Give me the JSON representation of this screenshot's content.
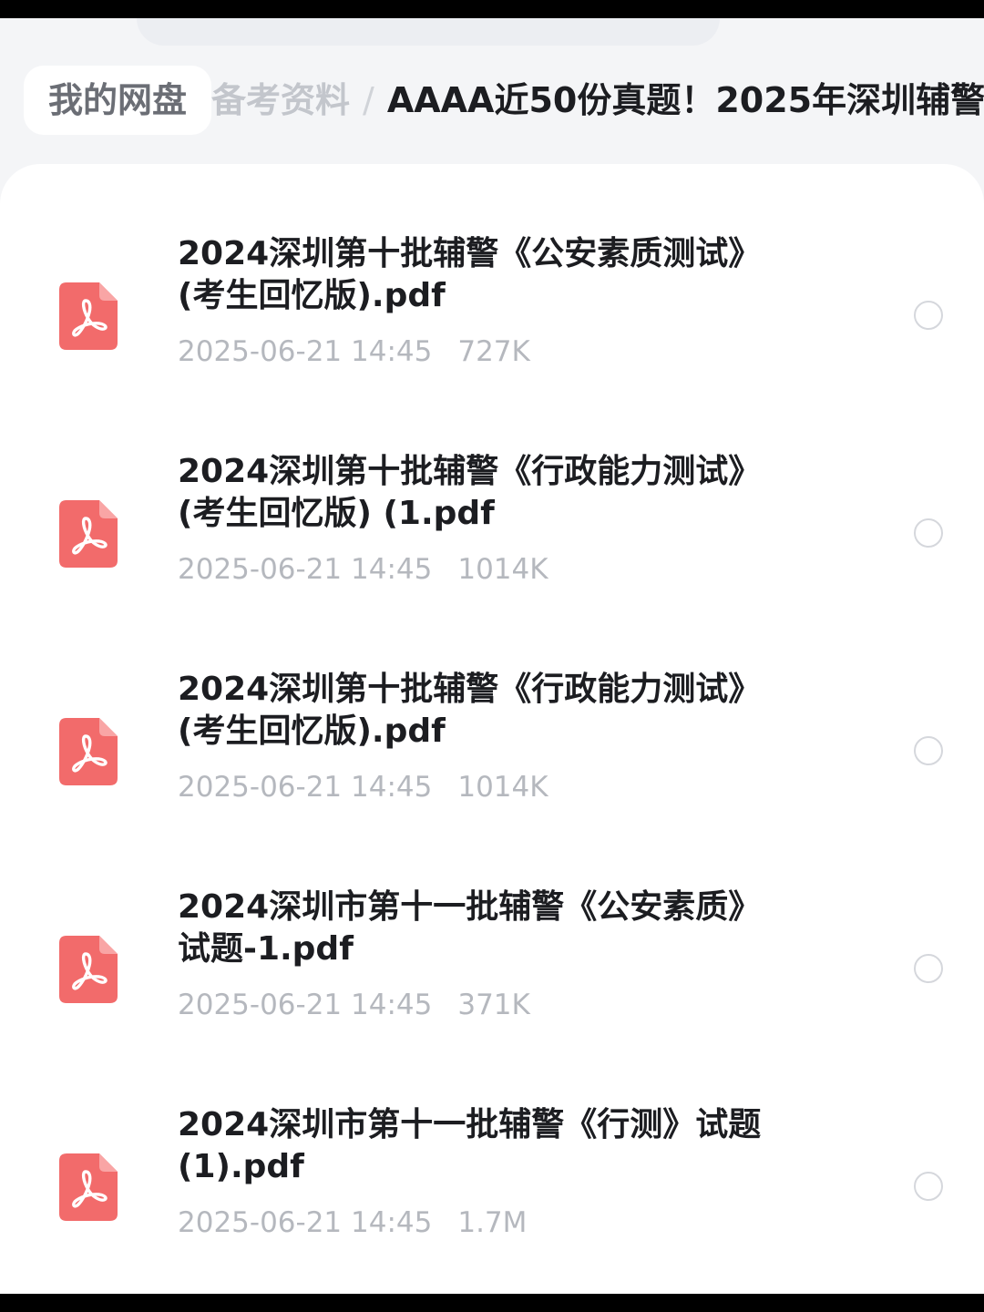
{
  "breadcrumb": {
    "root": "我的网盘",
    "parent": "备考资料",
    "separator": "/",
    "current": "AAAA近50份真题！2025年深圳辅警"
  },
  "files": [
    {
      "name_line1": "2024深圳第十批辅警《公安素质测试》",
      "name_line2": "(考生回忆版).pdf",
      "date": "2025-06-21 14:45",
      "size": "727K",
      "icon": "pdf-icon",
      "selected": false
    },
    {
      "name_line1": "2024深圳第十批辅警《行政能力测试》",
      "name_line2": "(考生回忆版) (1.pdf",
      "date": "2025-06-21 14:45",
      "size": "1014K",
      "icon": "pdf-icon",
      "selected": false
    },
    {
      "name_line1": "2024深圳第十批辅警《行政能力测试》",
      "name_line2": "(考生回忆版).pdf",
      "date": "2025-06-21 14:45",
      "size": "1014K",
      "icon": "pdf-icon",
      "selected": false
    },
    {
      "name_line1": "2024深圳市第十一批辅警《公安素质》",
      "name_line2": "试题-1.pdf",
      "date": "2025-06-21 14:45",
      "size": "371K",
      "icon": "pdf-icon",
      "selected": false
    },
    {
      "name_line1": "2024深圳市第十一批辅警《行测》试题",
      "name_line2": "(1).pdf",
      "date": "2025-06-21 14:45",
      "size": "1.7M",
      "icon": "pdf-icon",
      "selected": false
    }
  ],
  "colors": {
    "pdf_icon": "#f26b6b",
    "title_text": "#1c1d21",
    "meta_text": "#b5b8be",
    "radio_border": "#d5d7dc"
  }
}
